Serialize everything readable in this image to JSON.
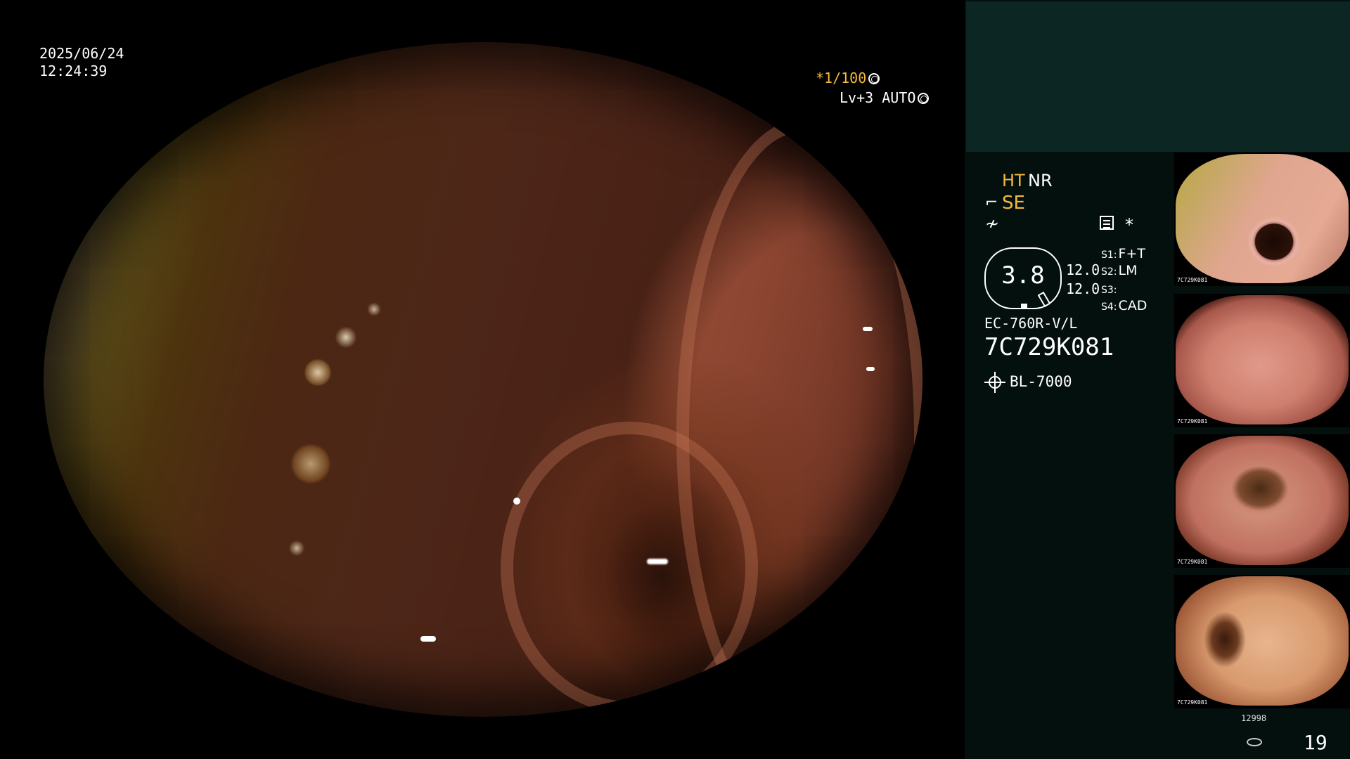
{
  "overlay": {
    "date": "2025/06/24",
    "time": "12:24:39",
    "shutter_prefix": "*",
    "shutter": "1/100",
    "level": "Lv+3",
    "iris": "AUTO"
  },
  "processor": {
    "enhancement_ht": "HT",
    "noise_reduction": "NR",
    "structure": "SE",
    "asterisk": "*",
    "gauge_value": "3.8",
    "gain_1": "12.0",
    "gain_2": "12.0",
    "switches": [
      {
        "key": "S1:",
        "value": "F+T"
      },
      {
        "key": "S2:",
        "value": "LM"
      },
      {
        "key": "S3:",
        "value": ""
      },
      {
        "key": "S4:",
        "value": "CAD"
      }
    ],
    "scope_model": "EC-760R-V/L",
    "scope_serial": "7C729K081",
    "light_source": "BL-7000"
  },
  "thumbnails": [
    {
      "label": "7C729K081"
    },
    {
      "label": "7C729K081"
    },
    {
      "label": "7C729K081"
    },
    {
      "label": "7C729K081"
    }
  ],
  "footer": {
    "storage_count": "12998",
    "image_count": "19"
  },
  "icons": {
    "shutter": "aperture-icon",
    "iris": "iris-icon",
    "structure": "structure-enhance-icon",
    "freeze": "freeze-icon",
    "memo": "memo-icon",
    "light": "light-source-icon",
    "storage": "storage-disk-icon"
  },
  "colors": {
    "accent": "#f5b93a",
    "panel_bg": "#04100e",
    "panel_top": "#0c2624"
  }
}
